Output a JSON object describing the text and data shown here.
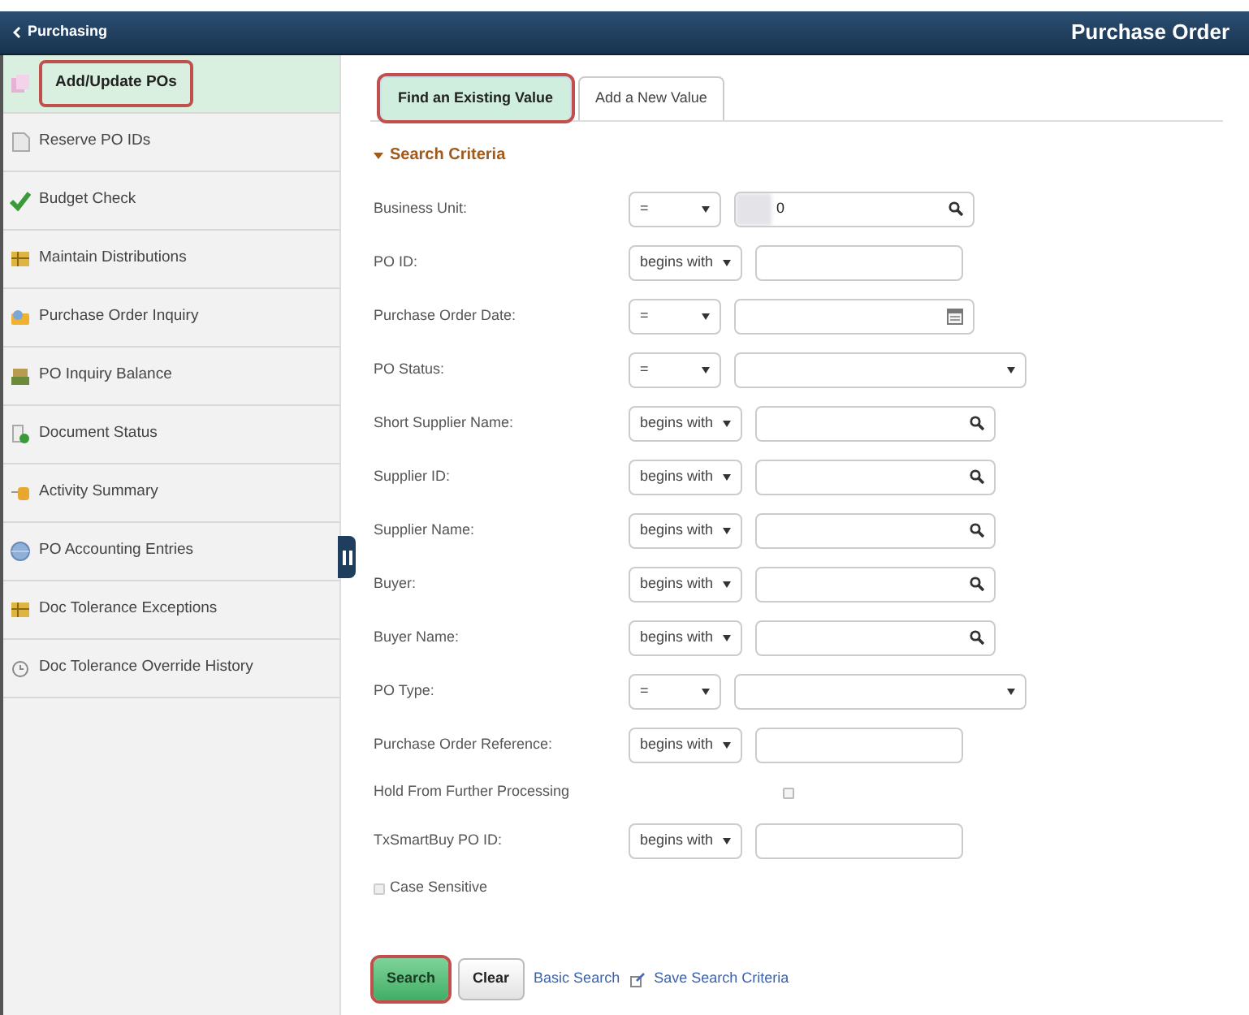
{
  "header": {
    "back_link": "Purchasing",
    "title": "Purchase Order"
  },
  "sidebar": {
    "items": [
      {
        "label": "Add/Update POs",
        "selected": true,
        "highlighted": true
      },
      {
        "label": "Reserve PO IDs",
        "selected": false,
        "highlighted": false
      },
      {
        "label": "Budget Check",
        "selected": false,
        "highlighted": false
      },
      {
        "label": "Maintain Distributions",
        "selected": false,
        "highlighted": false
      },
      {
        "label": "Purchase Order Inquiry",
        "selected": false,
        "highlighted": false
      },
      {
        "label": "PO Inquiry Balance",
        "selected": false,
        "highlighted": false
      },
      {
        "label": "Document Status",
        "selected": false,
        "highlighted": false
      },
      {
        "label": "Activity Summary",
        "selected": false,
        "highlighted": false
      },
      {
        "label": "PO Accounting Entries",
        "selected": false,
        "highlighted": false
      },
      {
        "label": "Doc Tolerance Exceptions",
        "selected": false,
        "highlighted": false
      },
      {
        "label": "Doc Tolerance Override History",
        "selected": false,
        "highlighted": false
      }
    ]
  },
  "tabs": [
    {
      "label": "Find an Existing Value",
      "selected": true,
      "highlighted": true
    },
    {
      "label": "Add a New Value",
      "selected": false,
      "highlighted": false
    }
  ],
  "search_criteria": {
    "heading": "Search Criteria",
    "expanded": true,
    "rows": [
      {
        "kind": "search",
        "label": "Business Unit:",
        "operator": "=",
        "value": "0",
        "redacted": true
      },
      {
        "kind": "text",
        "label": "PO ID:",
        "operator": "begins with"
      },
      {
        "kind": "date",
        "label": "Purchase Order Date:",
        "operator": "="
      },
      {
        "kind": "dropdown",
        "label": "PO Status:",
        "operator": "="
      },
      {
        "kind": "search",
        "label": "Short Supplier Name:",
        "operator": "begins with"
      },
      {
        "kind": "search",
        "label": "Supplier ID:",
        "operator": "begins with"
      },
      {
        "kind": "search",
        "label": "Supplier Name:",
        "operator": "begins with"
      },
      {
        "kind": "search",
        "label": "Buyer:",
        "operator": "begins with"
      },
      {
        "kind": "search",
        "label": "Buyer Name:",
        "operator": "begins with"
      },
      {
        "kind": "dropdown",
        "label": "PO Type:",
        "operator": "="
      },
      {
        "kind": "text",
        "label": "Purchase Order Reference:",
        "operator": "begins with"
      },
      {
        "kind": "checkbox",
        "label": "Hold From Further Processing",
        "checked": false
      },
      {
        "kind": "text",
        "label": "TxSmartBuy PO ID:",
        "operator": "begins with"
      }
    ],
    "case_sensitive": {
      "label": "Case Sensitive",
      "checked": false
    }
  },
  "buttons": [
    {
      "label": "Search",
      "kind": "primary",
      "highlighted": true
    },
    {
      "label": "Clear",
      "kind": "secondary",
      "highlighted": false
    }
  ],
  "links": [
    {
      "label": "Basic Search",
      "kind": "plain"
    },
    {
      "label": "Save Search Criteria",
      "kind": "with_icon"
    }
  ]
}
